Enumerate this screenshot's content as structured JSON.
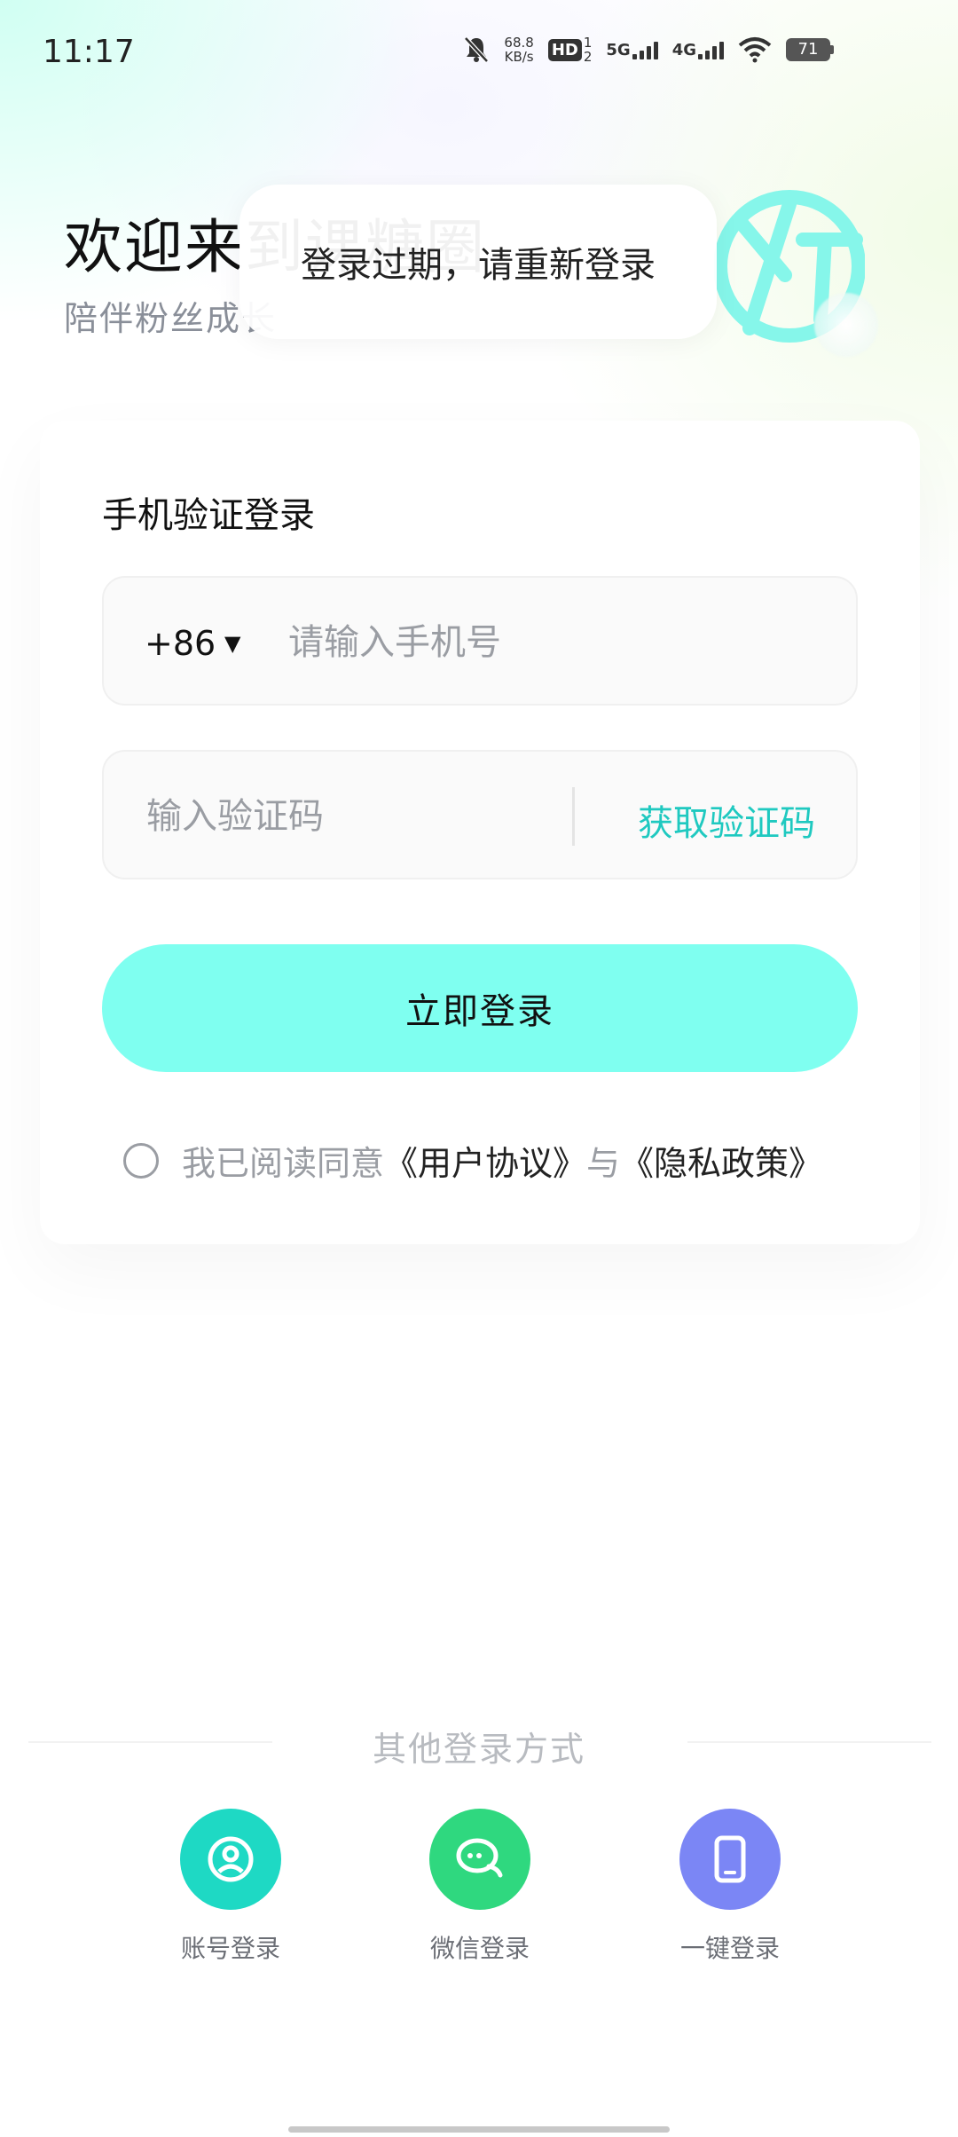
{
  "status_bar": {
    "time": "11:17",
    "speed_value": "68.8",
    "speed_unit": "KB/s",
    "hd": "HD",
    "sim1": "1",
    "sim2": "2",
    "net1": "5G",
    "net2": "4G",
    "battery": "71"
  },
  "header": {
    "title": "欢迎来到课糖圈",
    "subtitle": "陪伴粉丝成长"
  },
  "toast": {
    "message": "登录过期，请重新登录"
  },
  "login_card": {
    "title": "手机验证登录",
    "country_code": "+86",
    "phone_placeholder": "请输入手机号",
    "code_placeholder": "输入验证码",
    "get_code_label": "获取验证码",
    "login_button": "立即登录",
    "agreement_prefix": "我已阅读同意",
    "user_agreement": "《用户协议》",
    "agreement_joiner": "与",
    "privacy_policy": "《隐私政策》"
  },
  "other_login": {
    "title": "其他登录方式",
    "methods": [
      {
        "label": "账号登录",
        "icon": "user-icon",
        "color": "#1ed9c4"
      },
      {
        "label": "微信登录",
        "icon": "wechat-icon",
        "color": "#2fd87f"
      },
      {
        "label": "一键登录",
        "icon": "phone-icon",
        "color": "#7b86f5"
      }
    ]
  },
  "colors": {
    "accent": "#1fc9c0",
    "button": "#7ffff0"
  }
}
